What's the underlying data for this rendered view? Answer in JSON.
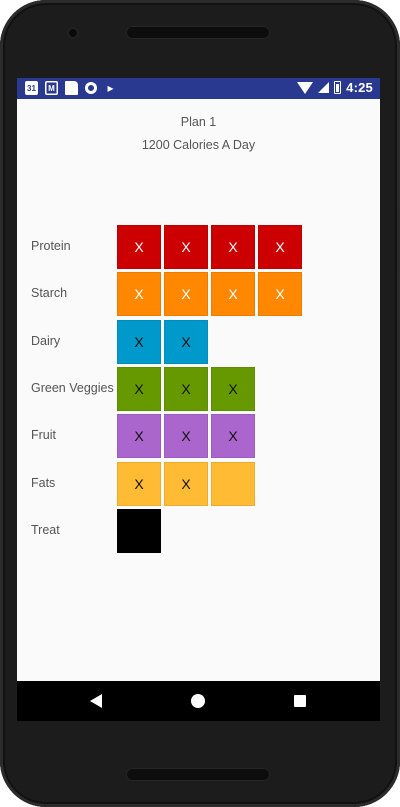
{
  "status_bar": {
    "time": "4:25",
    "calendar_day": "31",
    "left_icons": [
      "calendar-icon",
      "gmail-icon",
      "sd-card-icon",
      "circle-notification-icon",
      "play-store-icon"
    ],
    "right_icons": [
      "wifi-icon",
      "signal-icon",
      "battery-icon"
    ],
    "bg_color": "#2a3990"
  },
  "plan": {
    "title": "Plan 1",
    "subtitle": "1200 Calories A Day"
  },
  "food_groups": [
    {
      "label": "Protein",
      "color": "#cc0000",
      "mark_color": "#ffffff",
      "cells": [
        "X",
        "X",
        "X",
        "X"
      ]
    },
    {
      "label": "Starch",
      "color": "#ff8800",
      "mark_color": "#ffffff",
      "cells": [
        "X",
        "X",
        "X",
        "X"
      ]
    },
    {
      "label": "Dairy",
      "color": "#0099cc",
      "mark_color": "#111111",
      "cells": [
        "X",
        "X"
      ]
    },
    {
      "label": "Green Veggies",
      "color": "#669900",
      "mark_color": "#111111",
      "cells": [
        "X",
        "X",
        "X"
      ]
    },
    {
      "label": "Fruit",
      "color": "#aa66cc",
      "mark_color": "#111111",
      "cells": [
        "X",
        "X",
        "X"
      ]
    },
    {
      "label": "Fats",
      "color": "#ffbb33",
      "mark_color": "#111111",
      "cells": [
        "X",
        "X",
        ""
      ]
    },
    {
      "label": "Treat",
      "color": "#000000",
      "mark_color": "#ffffff",
      "cells": [
        ""
      ]
    }
  ],
  "nav_bar": {
    "buttons": [
      "back-icon",
      "home-icon",
      "recents-icon"
    ]
  }
}
